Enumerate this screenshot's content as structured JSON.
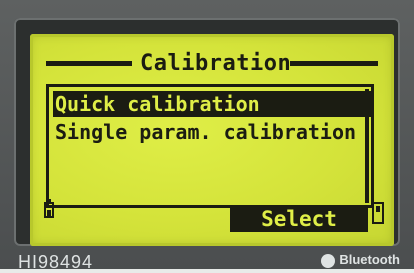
{
  "screen": {
    "title": "Calibration",
    "menu_items": [
      {
        "label": "Quick calibration",
        "selected": true
      },
      {
        "label": "Single param. calibration",
        "selected": false
      }
    ],
    "softkey_label": "Select"
  },
  "device": {
    "model": "HI98494",
    "bluetooth_label": "Bluetooth"
  },
  "colors": {
    "lcd_background": "#dfee47",
    "lcd_text": "#1b1c12",
    "bezel": "#4b4e4f"
  },
  "icons": [
    "battery-icon",
    "memory-icon",
    "bluetooth-icon"
  ]
}
